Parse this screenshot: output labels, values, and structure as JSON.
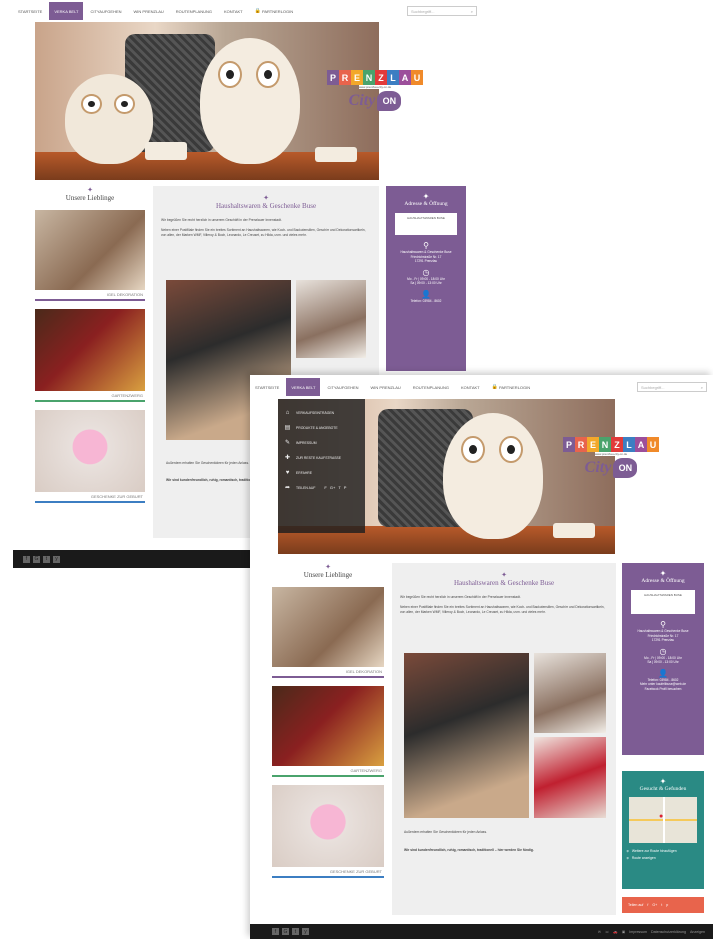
{
  "nav": {
    "items": [
      "STARTSEITE",
      "VERKA BELT",
      "CITYAUFGEHEN",
      "WIN PRENZLAU",
      "ROUTENPLANUNG",
      "KONTAKT",
      "PARTNERLOGIN"
    ],
    "search_placeholder": "Suchbegriff..."
  },
  "logo": {
    "letters": [
      "P",
      "R",
      "E",
      "N",
      "Z",
      "L",
      "A",
      "U"
    ],
    "letter_colors": [
      "#7d5c94",
      "#e8644c",
      "#f3a82a",
      "#4aa36c",
      "#e23a3a",
      "#3c7ec2",
      "#9c4f9b",
      "#f08a2a"
    ],
    "tagline": "www.prenzlau-city.on.de",
    "city": "City",
    "on": "ON"
  },
  "menu": {
    "items": [
      {
        "icon": "⌂",
        "label": "VERKAUFSEINTRÄGEN"
      },
      {
        "icon": "▤",
        "label": "PRODUKTE & ANGEBOTE"
      },
      {
        "icon": "✎",
        "label": "IMPRESSUM"
      },
      {
        "icon": "✚",
        "label": "ZUR RESTE KAUFSTRASSE"
      },
      {
        "icon": "♥",
        "label": "ERFAHRE"
      }
    ],
    "share_label": "TEILEN AUF",
    "share_icons": [
      "f",
      "G+",
      "t",
      "p"
    ]
  },
  "favorites": {
    "title": "Unsere Lieblinge",
    "items": [
      {
        "caption": "IGEL DEKORATION",
        "accent": "#7d5c94"
      },
      {
        "caption": "GARTENZWERG",
        "accent": "#4aa36c"
      },
      {
        "caption": "GESCHENKE ZUR GEBURT",
        "accent": "#3c7ec2"
      }
    ]
  },
  "content": {
    "title": "Haushaltswaren & Geschenke Buse",
    "intro": "Wir begrüßen Sie recht herzlich in unserem Geschäft in der Prenzlauer Innenstadt.",
    "paragraph": "Neben einer Postfiliale finden Sie ein breites Sortiment an Haushaltswaren, wie Koch- und Backutensilien, Geschirr und Dekorationsartikeln, von allen, der Marken WMF, Villeroy & Boch, Leonardo, Le Creuset, zu Hilda, uvm. und vieles mehr.",
    "extra": "Außerdem erhalten Sie Geschenkideen für jeden Anlass.",
    "slogan": "Wir sind kundenfreundlich, ruhig, romantisch, traditionell – hier werden Sie fündig."
  },
  "sidebar": {
    "title": "Adresse & Öffnung",
    "shop_name": "HAUSHALTSWAREN BUSE",
    "address": [
      "Haushaltswaren & Geschenke Buse",
      "Friedrichstraße Nr. 17",
      "17291 Prenzlau"
    ],
    "hours": [
      "Mo - Fr  | 09:00 - 18:00 Uhr",
      "Sa       | 09:00 - 13:00 Uhr"
    ],
    "contact": [
      "Telefon: 03984 - 8602",
      "Mehr unter kaufeltbuse@web.de",
      "Facebook Profil besuchen"
    ],
    "map_title": "Gesucht & Gefunden",
    "map_links": [
      "Weitere zur Route hinzufügen",
      "Route anzeigen"
    ],
    "social_label": "Teilen auf",
    "social_icons": [
      "f",
      "G+",
      "t",
      "p"
    ]
  },
  "footer": {
    "icons": [
      "f",
      "G",
      "t",
      "y"
    ],
    "links": [
      "Impressum",
      "Datenschutzerklärung",
      "Anzeigen"
    ]
  }
}
